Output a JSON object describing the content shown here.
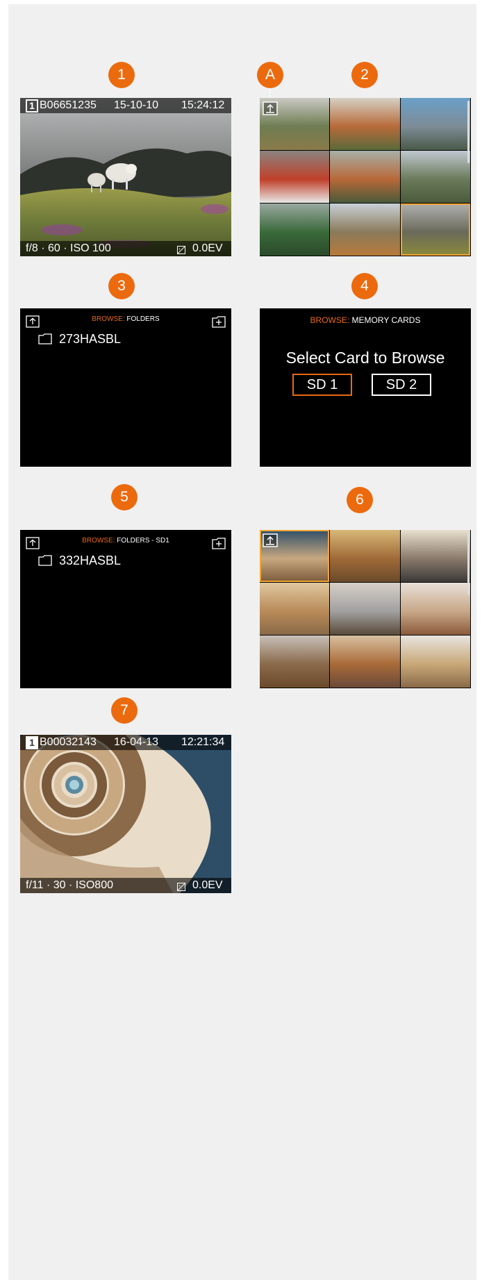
{
  "badges": {
    "b1": "1",
    "bA": "A",
    "b2": "2",
    "b3": "3",
    "b4": "4",
    "b5": "5",
    "b6": "6",
    "b7": "7"
  },
  "screen1": {
    "card": "1",
    "image_id": "B06651235",
    "date": "15-10-10",
    "time": "15:24:12",
    "exposure": "f/8 · 60 · ISO 100",
    "ev": "0.0EV",
    "ev_icon": "exposure-compensation-icon"
  },
  "screen2": {
    "selected_index": 8,
    "up_icon": "folder-up-icon"
  },
  "screen3": {
    "title_prefix": "BROWSE:",
    "title_rest": " FOLDERS",
    "folders": [
      "273HASBL"
    ]
  },
  "screen4": {
    "title_prefix": "BROWSE:",
    "title_rest": " MEMORY CARDS",
    "prompt": "Select Card to Browse",
    "cards": [
      "SD 1",
      "SD 2"
    ],
    "selected_card": "SD 1"
  },
  "screen5": {
    "title_prefix": "BROWSE:",
    "title_rest": " FOLDERS - SD1",
    "folders": [
      "332HASBL"
    ]
  },
  "screen6": {
    "selected_index": 0,
    "up_icon": "folder-up-icon"
  },
  "screen7": {
    "card": "1",
    "image_id": "B00032143",
    "date": "16-04-13",
    "time": "12:21:34",
    "exposure": "f/11 · 30 · ISO800",
    "ev": "0.0EV"
  },
  "colors": {
    "accent": "#ec6a0e",
    "highlight": "#e9690f",
    "selection": "#f3a531"
  }
}
